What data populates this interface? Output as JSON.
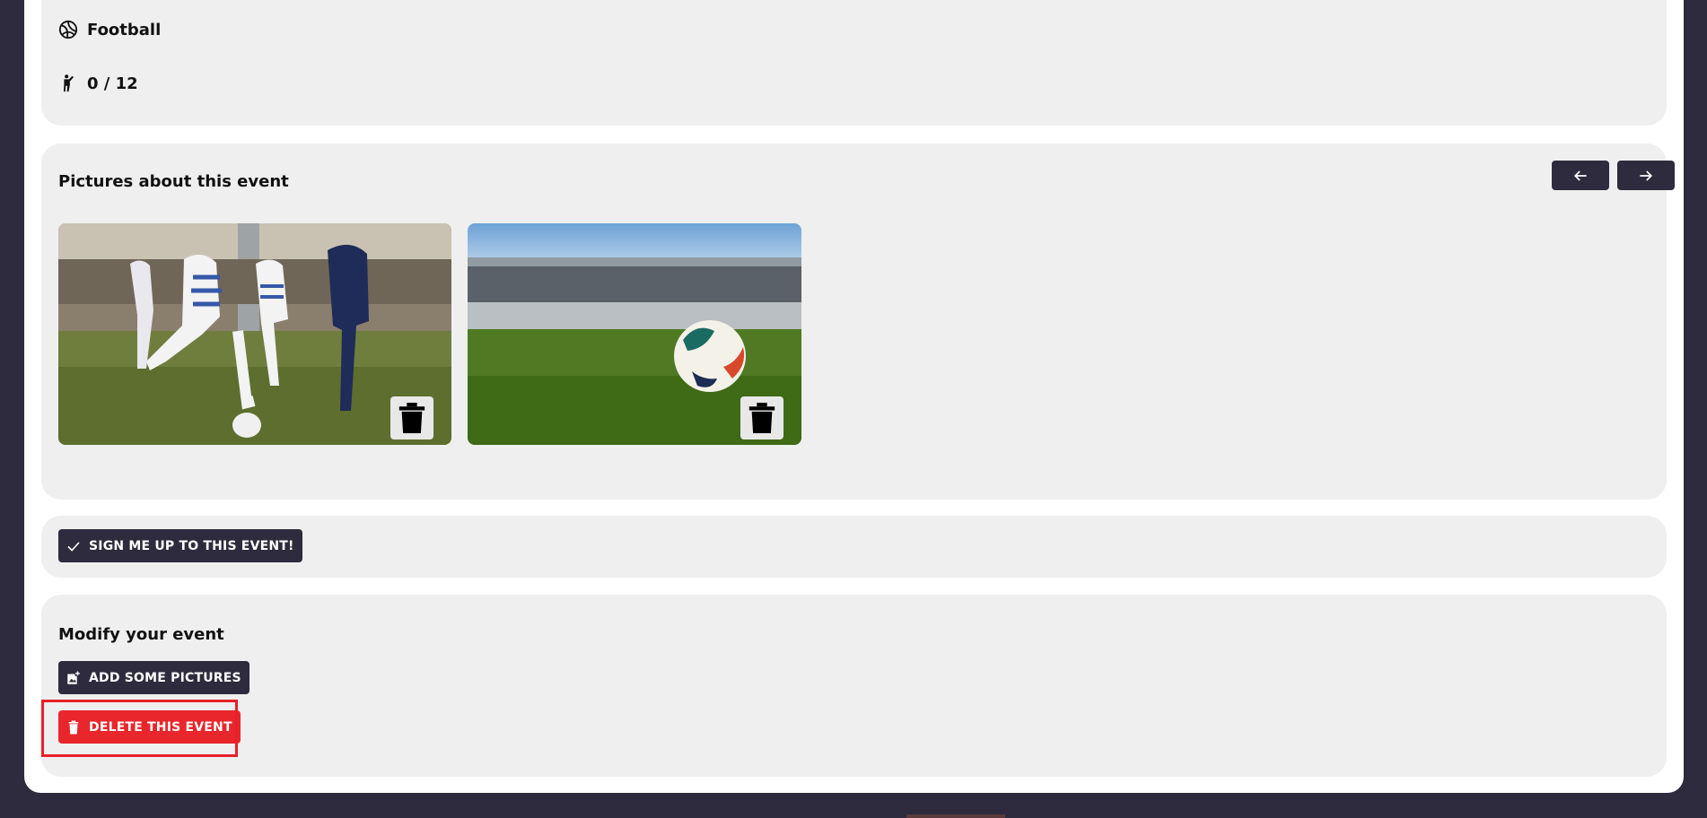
{
  "event_info": {
    "sport": "Football",
    "participants": "0 / 12",
    "sport_icon": "volleyball-icon",
    "participants_icon": "person-icon"
  },
  "pictures": {
    "title": "Pictures about this event",
    "prev_icon": "arrow-left-icon",
    "next_icon": "arrow-right-icon",
    "items": [
      {
        "subject": "women players kicking ball"
      },
      {
        "subject": "ball on stadium grass"
      }
    ],
    "delete_icon": "trash-icon"
  },
  "signup": {
    "label": "SIGN ME UP TO THIS EVENT!",
    "icon": "check-icon"
  },
  "modify": {
    "title": "Modify your event",
    "add_pictures_label": "ADD SOME PICTURES",
    "add_pictures_icon": "add-photo-icon",
    "delete_label": "DELETE THIS EVENT",
    "delete_icon": "trash-icon"
  },
  "colors": {
    "dark": "#2d2b3d",
    "card": "#efefef",
    "danger": "#e8262b",
    "highlight": "#e8202a"
  }
}
